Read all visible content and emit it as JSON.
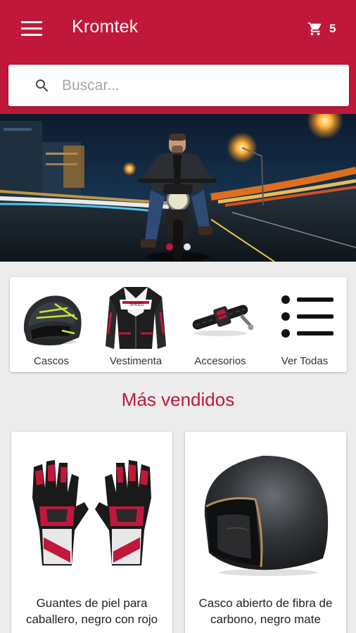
{
  "app": {
    "title": "Kromtek"
  },
  "header": {
    "cart_count": "5"
  },
  "search": {
    "placeholder": "Buscar..."
  },
  "banner": {
    "slide_count": 2,
    "active_slide": 1
  },
  "categories": [
    {
      "label": "Cascos",
      "icon": "helmet-icon"
    },
    {
      "label": "Vestimenta",
      "icon": "jacket-icon"
    },
    {
      "label": "Accesorios",
      "icon": "chain-lock-icon"
    },
    {
      "label": "Ver Todas",
      "icon": "list-icon"
    }
  ],
  "best_sellers": {
    "title": "Más vendidos",
    "products": [
      {
        "name": "Guantes de piel para caballero, negro con rojo"
      },
      {
        "name": "Casco abierto de fibra de carbono, negro mate"
      }
    ]
  },
  "colors": {
    "primary": "#c0183a",
    "background": "#ececec"
  }
}
